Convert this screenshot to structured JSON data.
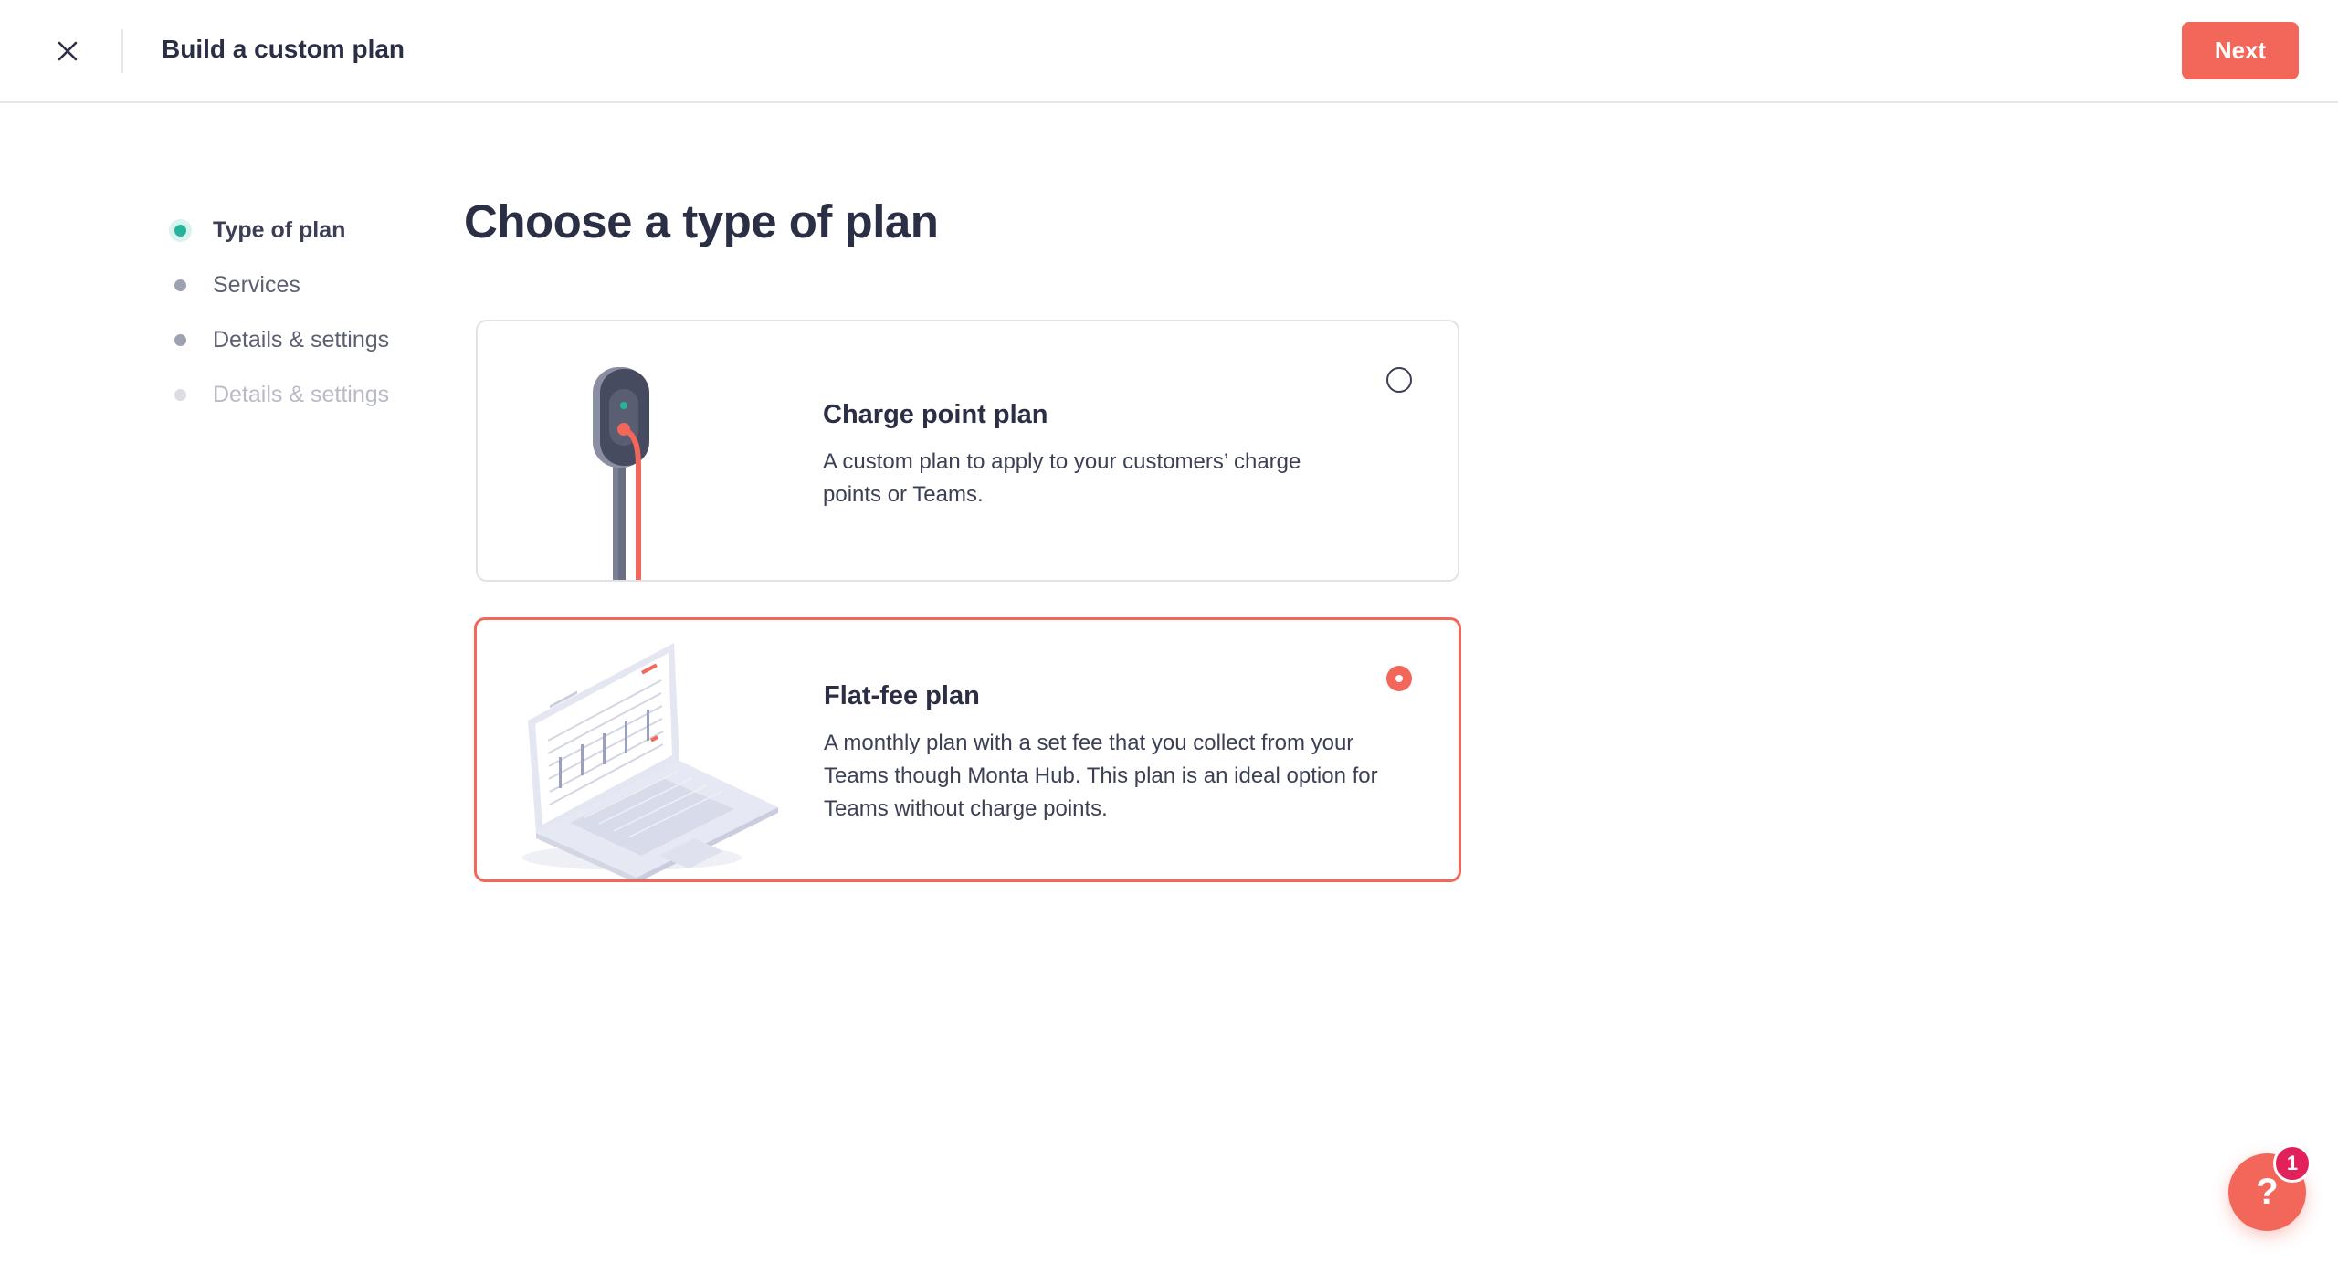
{
  "header": {
    "title": "Build a custom plan",
    "close_icon": "close-icon",
    "next_label": "Next"
  },
  "stepper": {
    "steps": [
      {
        "label": "Type of plan",
        "state": "active"
      },
      {
        "label": "Services",
        "state": "normal"
      },
      {
        "label": "Details & settings",
        "state": "normal"
      },
      {
        "label": "Details & settings",
        "state": "faded"
      }
    ]
  },
  "main": {
    "title": "Choose a type of plan",
    "plans": [
      {
        "title": "Charge point plan",
        "description": "A custom plan to apply to your customers’ charge points or Teams.",
        "selected": false,
        "illustration": "charger-illustration"
      },
      {
        "title": "Flat-fee plan",
        "description": "A monthly plan with a set fee that you collect from your Teams though Monta Hub. This plan is an ideal option for Teams without charge points.",
        "selected": true,
        "illustration": "laptop-illustration"
      }
    ]
  },
  "help": {
    "icon": "question-icon",
    "glyph": "?",
    "badge_count": "1"
  },
  "colors": {
    "accent": "#f3665a",
    "active_step": "#27b39b",
    "badge": "#e0215a",
    "text": "#2b2f45"
  }
}
